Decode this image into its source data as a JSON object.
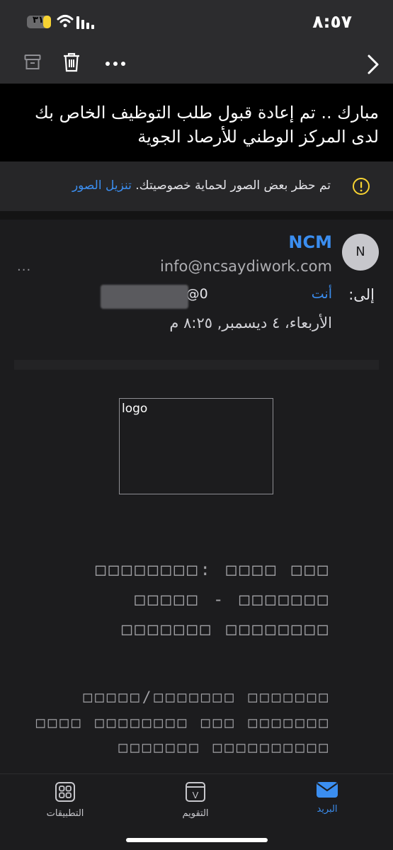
{
  "status_bar": {
    "time": "٨:٥٧",
    "battery_label": "٣١",
    "battery_level": 0.31
  },
  "toolbar": {
    "archive_icon": "archive-icon",
    "trash_icon": "trash-icon",
    "more_icon": "more-icon",
    "back_icon": "chevron-right-icon"
  },
  "subject": {
    "text": "مبارك .. تم إعادة قبول طلب التوظيف الخاص بك لدى المركز الوطني للأرصاد الجوية"
  },
  "privacy": {
    "message": "تم حظر بعض الصور لحماية خصوصيتك.",
    "link": "تنزيل الصور"
  },
  "header": {
    "avatar_initial": "N",
    "sender_name": "NCM",
    "sender_email": "info@ncsaydiwork.com",
    "more": "...",
    "to_label": "إلى:",
    "to_you": "أنت",
    "to_email": "0@hotmail.com",
    "date": "الأربعاء، ٤ ديسمبر, ٨:٢٥ م"
  },
  "body": {
    "logo_alt": "logo",
    "lines": [
      "□□□ □□□□ :□□□□□□□□",
      "□□□□□□□ - □□□□□",
      "□□□□□□□□ □□□□□□□",
      "□□□□□□□ □□□□□□□/□□□□□",
      "□□□□□□□ □□□ □□□□□□□□ □□□□",
      "□□□□□□□□□□ □□□□□□□"
    ]
  },
  "tabbar": {
    "mail": "البريد",
    "calendar": "التقويم",
    "apps": "التطبيقات",
    "calendar_glyph": "V"
  },
  "colors": {
    "accent": "#3b8ef0",
    "background": "#1c1c1e",
    "battery": "#f7d332"
  }
}
